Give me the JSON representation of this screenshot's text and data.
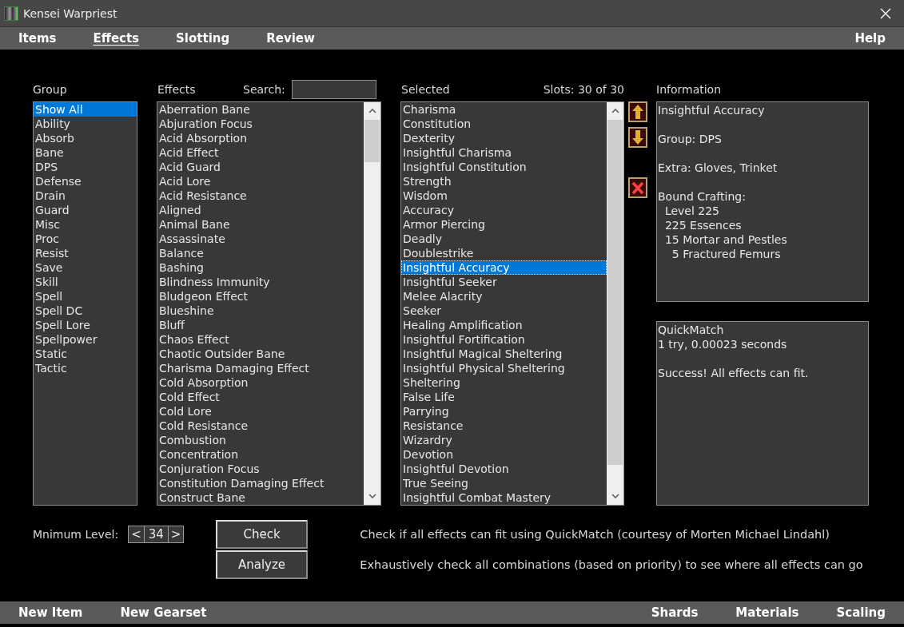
{
  "window": {
    "title": "Kensei Warpriest"
  },
  "menu": [
    {
      "label": "Items",
      "selected": false
    },
    {
      "label": "Effects",
      "selected": true
    },
    {
      "label": "Slotting",
      "selected": false
    },
    {
      "label": "Review",
      "selected": false
    }
  ],
  "help": "Help",
  "group": {
    "heading": "Group",
    "items": [
      {
        "label": "Show All",
        "selected": true
      },
      {
        "label": "Ability",
        "selected": false
      },
      {
        "label": "Absorb",
        "selected": false
      },
      {
        "label": "Bane",
        "selected": false
      },
      {
        "label": "DPS",
        "selected": false
      },
      {
        "label": "Defense",
        "selected": false
      },
      {
        "label": "Drain",
        "selected": false
      },
      {
        "label": "Guard",
        "selected": false
      },
      {
        "label": "Misc",
        "selected": false
      },
      {
        "label": "Proc",
        "selected": false
      },
      {
        "label": "Resist",
        "selected": false
      },
      {
        "label": "Save",
        "selected": false
      },
      {
        "label": "Skill",
        "selected": false
      },
      {
        "label": "Spell",
        "selected": false
      },
      {
        "label": "Spell DC",
        "selected": false
      },
      {
        "label": "Spell Lore",
        "selected": false
      },
      {
        "label": "Spellpower",
        "selected": false
      },
      {
        "label": "Static",
        "selected": false
      },
      {
        "label": "Tactic",
        "selected": false
      }
    ]
  },
  "effects": {
    "heading": "Effects",
    "search_label": "Search:",
    "items": [
      {
        "label": "Aberration Bane",
        "selected": false
      },
      {
        "label": "Abjuration Focus",
        "selected": false
      },
      {
        "label": "Acid Absorption",
        "selected": false
      },
      {
        "label": "Acid Effect",
        "selected": false
      },
      {
        "label": "Acid Guard",
        "selected": false
      },
      {
        "label": "Acid Lore",
        "selected": false
      },
      {
        "label": "Acid Resistance",
        "selected": false
      },
      {
        "label": "Aligned",
        "selected": false
      },
      {
        "label": "Animal Bane",
        "selected": false
      },
      {
        "label": "Assassinate",
        "selected": false
      },
      {
        "label": "Balance",
        "selected": false
      },
      {
        "label": "Bashing",
        "selected": false
      },
      {
        "label": "Blindness Immunity",
        "selected": false
      },
      {
        "label": "Bludgeon Effect",
        "selected": false
      },
      {
        "label": "Blueshine",
        "selected": false
      },
      {
        "label": "Bluff",
        "selected": false
      },
      {
        "label": "Chaos Effect",
        "selected": false
      },
      {
        "label": "Chaotic Outsider Bane",
        "selected": false
      },
      {
        "label": "Charisma Damaging Effect",
        "selected": false
      },
      {
        "label": "Cold Absorption",
        "selected": false
      },
      {
        "label": "Cold Effect",
        "selected": false
      },
      {
        "label": "Cold Lore",
        "selected": false
      },
      {
        "label": "Cold Resistance",
        "selected": false
      },
      {
        "label": "Combustion",
        "selected": false
      },
      {
        "label": "Concentration",
        "selected": false
      },
      {
        "label": "Conjuration Focus",
        "selected": false
      },
      {
        "label": "Constitution Damaging Effect",
        "selected": false
      },
      {
        "label": "Construct Bane",
        "selected": false
      }
    ]
  },
  "selected": {
    "heading": "Selected",
    "slots": "Slots: 30 of 30",
    "items": [
      {
        "label": "Charisma",
        "selected": false
      },
      {
        "label": "Constitution",
        "selected": false
      },
      {
        "label": "Dexterity",
        "selected": false
      },
      {
        "label": "Insightful Charisma",
        "selected": false
      },
      {
        "label": "Insightful Constitution",
        "selected": false
      },
      {
        "label": "Strength",
        "selected": false
      },
      {
        "label": "Wisdom",
        "selected": false
      },
      {
        "label": "Accuracy",
        "selected": false
      },
      {
        "label": "Armor Piercing",
        "selected": false
      },
      {
        "label": "Deadly",
        "selected": false
      },
      {
        "label": "Doublestrike",
        "selected": false
      },
      {
        "label": "Insightful Accuracy",
        "selected": true
      },
      {
        "label": "Insightful Seeker",
        "selected": false
      },
      {
        "label": "Melee Alacrity",
        "selected": false
      },
      {
        "label": "Seeker",
        "selected": false
      },
      {
        "label": "Healing Amplification",
        "selected": false
      },
      {
        "label": "Insightful Fortification",
        "selected": false
      },
      {
        "label": "Insightful Magical Sheltering",
        "selected": false
      },
      {
        "label": "Insightful Physical Sheltering",
        "selected": false
      },
      {
        "label": "Sheltering",
        "selected": false
      },
      {
        "label": "False Life",
        "selected": false
      },
      {
        "label": "Parrying",
        "selected": false
      },
      {
        "label": "Resistance",
        "selected": false
      },
      {
        "label": "Wizardry",
        "selected": false
      },
      {
        "label": "Devotion",
        "selected": false
      },
      {
        "label": "Insightful Devotion",
        "selected": false
      },
      {
        "label": "True Seeing",
        "selected": false
      },
      {
        "label": "Insightful Combat Mastery",
        "selected": false
      }
    ]
  },
  "information": {
    "heading": "Information",
    "paragraphs": [
      [
        "Insightful Accuracy"
      ],
      [
        "Group: DPS"
      ],
      [
        "Extra: Gloves, Trinket"
      ],
      [
        "Bound Crafting:",
        "  Level 225",
        "  225 Essences",
        "  15 Mortar and Pestles",
        "    5 Fractured Femurs"
      ]
    ]
  },
  "quickmatch": {
    "paragraphs": [
      [
        "QuickMatch",
        "1 try, 0.00023 seconds"
      ],
      [
        "Success! All effects can fit."
      ]
    ]
  },
  "minimum_level": {
    "label": "Mnimum Level:",
    "decrease": "<",
    "value": "34",
    "increase": ">"
  },
  "actions": [
    {
      "label": "Check",
      "description": "Check if all effects can fit using QuickMatch (courtesy of Morten Michael Lindahl)"
    },
    {
      "label": "Analyze",
      "description": "Exhaustively check all combinations (based on priority) to see where all effects can go"
    }
  ],
  "bottom_left": [
    "New Item",
    "New Gearset"
  ],
  "bottom_right": [
    "Shards",
    "Materials",
    "Scaling"
  ]
}
